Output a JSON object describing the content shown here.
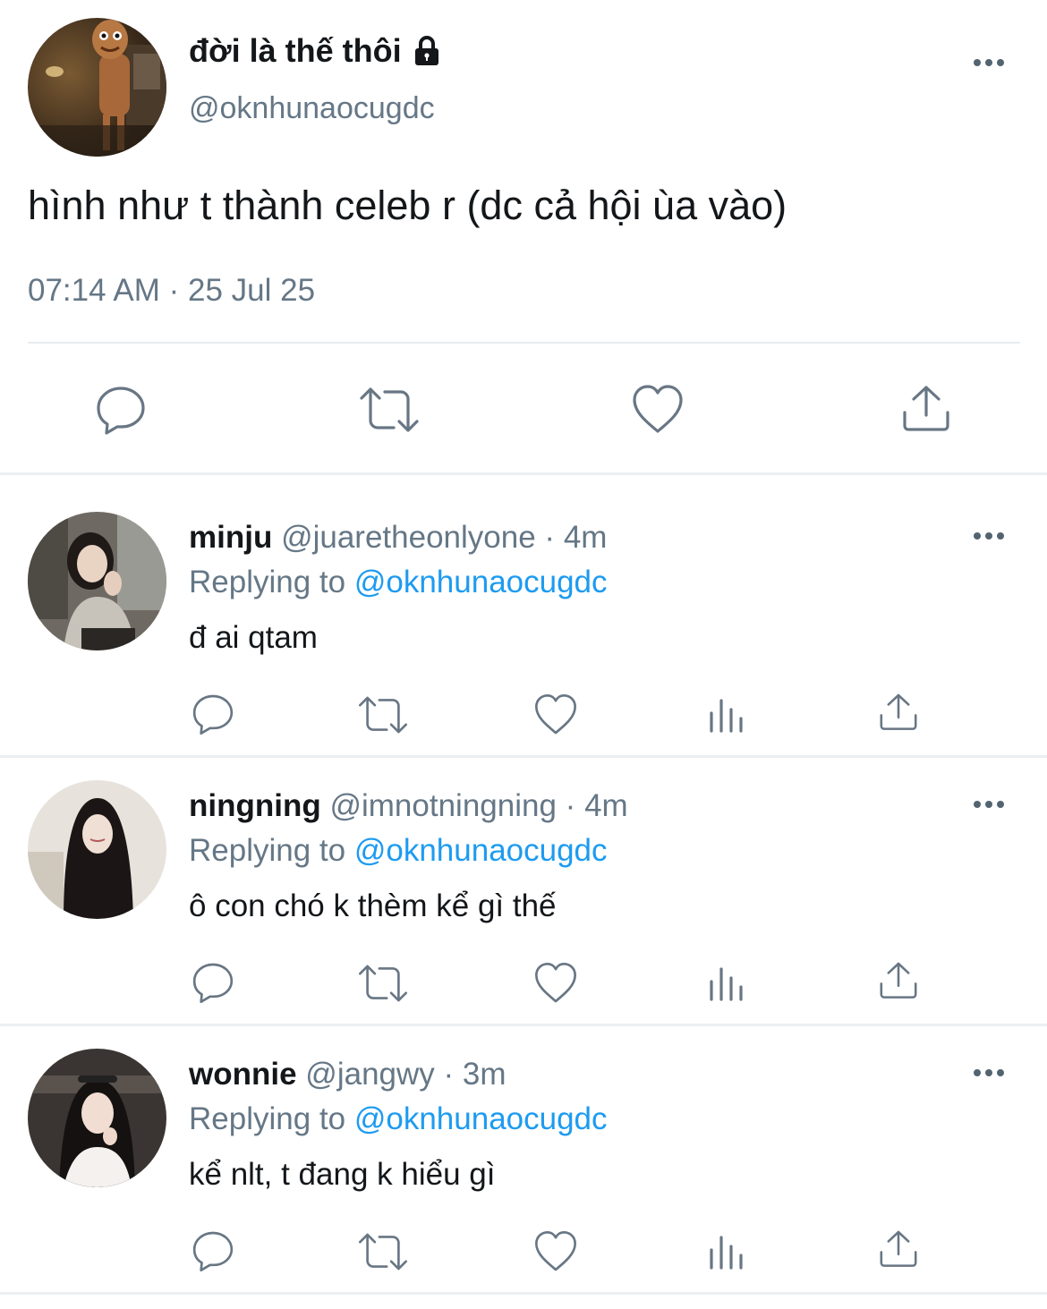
{
  "tweet": {
    "display_name": "đời là thế thôi",
    "handle": "@oknhunaocugdc",
    "text": "hình như t thành celeb r (dc cả hội ùa vào)",
    "timestamp": "07:14 AM · 25 Jul 25",
    "avatar_icon": "avatar-image",
    "lock_icon": "lock-icon",
    "actions": [
      "reply-icon",
      "retweet-icon",
      "like-icon",
      "share-icon"
    ]
  },
  "replies": [
    {
      "name": "minju",
      "handle": "@juaretheonlyone",
      "time": "4m",
      "replying_label": "Replying to",
      "replying_to": "@oknhunaocugdc",
      "text": "đ ai qtam"
    },
    {
      "name": "ningning",
      "handle": "@imnotningning",
      "time": "4m",
      "replying_label": "Replying to",
      "replying_to": "@oknhunaocugdc",
      "text": "ô con chó k thèm kể gì thế"
    },
    {
      "name": "wonnie",
      "handle": "@jangwy",
      "time": "3m",
      "replying_label": "Replying to",
      "replying_to": "@oknhunaocugdc",
      "text": "kể nlt, t đang k hiểu gì"
    }
  ],
  "colors": {
    "secondary_text": "#657786",
    "mention": "#1d9bf0",
    "icon": "#687684",
    "divider": "#e6ecf0"
  }
}
